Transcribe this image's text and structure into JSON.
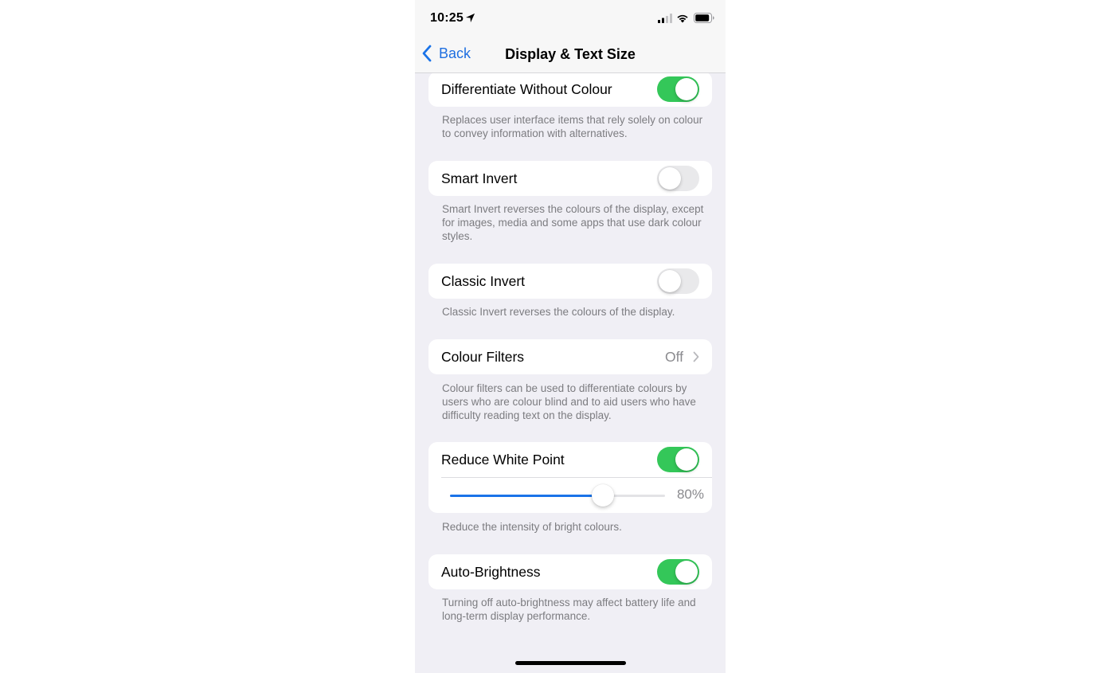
{
  "status_bar": {
    "time": "10:25",
    "icons": [
      "location-arrow-icon",
      "cellular-signal-icon",
      "wifi-icon",
      "battery-icon"
    ]
  },
  "nav": {
    "back_label": "Back",
    "title": "Display & Text Size"
  },
  "colors": {
    "accent": "#1a73e8",
    "toggle_on": "#34c759",
    "toggle_off": "#e9e9eb",
    "background": "#f0eff5"
  },
  "settings": [
    {
      "label": "Differentiate Without Colour",
      "type": "toggle",
      "on": true,
      "footer": "Replaces user interface items that rely solely on colour to convey information with alternatives."
    },
    {
      "label": "Smart Invert",
      "type": "toggle",
      "on": false,
      "footer": "Smart Invert reverses the colours of the display, except for images, media and some apps that use dark colour styles."
    },
    {
      "label": "Classic Invert",
      "type": "toggle",
      "on": false,
      "footer": "Classic Invert reverses the colours of the display."
    },
    {
      "label": "Colour Filters",
      "type": "disclosure",
      "value": "Off",
      "footer": "Colour filters can be used to differentiate colours by users who are colour blind and to aid users who have difficulty reading text on the display."
    },
    {
      "label": "Reduce White Point",
      "type": "toggle",
      "on": true,
      "slider": {
        "value_percent": 80,
        "fill_fraction": 0.71,
        "label": "80%"
      },
      "footer": "Reduce the intensity of bright colours."
    },
    {
      "label": "Auto-Brightness",
      "type": "toggle",
      "on": true,
      "footer": "Turning off auto-brightness may affect battery life and long-term display performance."
    }
  ]
}
